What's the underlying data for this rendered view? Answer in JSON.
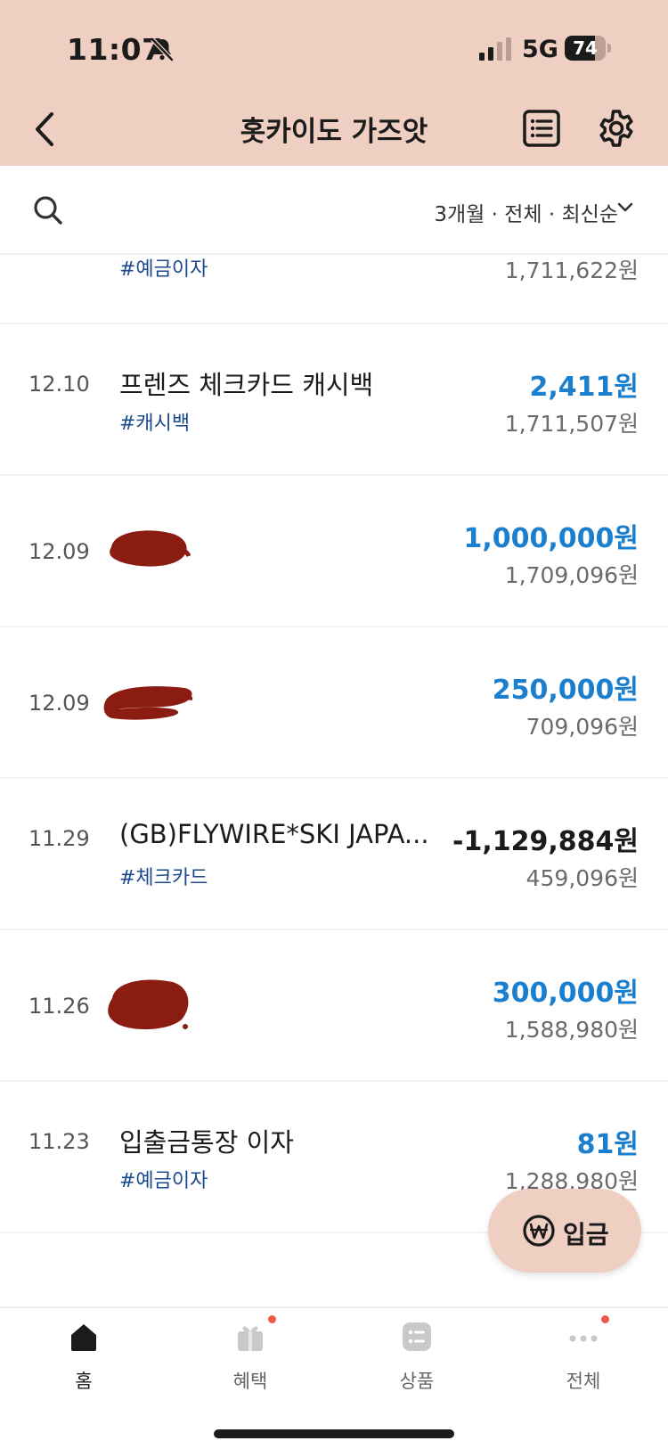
{
  "status_bar": {
    "time": "11:07",
    "network": "5G",
    "battery": 74,
    "battery_label": "74",
    "icons": [
      "bell-slash-icon",
      "signal-icon"
    ]
  },
  "nav": {
    "title": "홋카이도 가즈앗",
    "icons": [
      "back-icon",
      "list-icon",
      "gear-icon"
    ]
  },
  "filter": {
    "label": "3개월 · 전체 · 최신순",
    "icons": [
      "search-icon",
      "chevron-down-icon"
    ]
  },
  "transactions": [
    {
      "date": "",
      "name": "",
      "tag": "#예금이자",
      "amount": "",
      "balance": "1,711,622원"
    },
    {
      "date": "12.10",
      "name": "프렌즈 체크카드 캐시백",
      "tag": "#캐시백",
      "amount": "2,411원",
      "balance": "1,711,507원"
    },
    {
      "date": "12.09",
      "name": "",
      "tag": "",
      "amount": "1,000,000원",
      "balance": "1,709,096원"
    },
    {
      "date": "12.09",
      "name": "",
      "tag": "",
      "amount": "250,000원",
      "balance": "709,096원"
    },
    {
      "date": "11.29",
      "name": "(GB)FLYWIRE*SKI JAPA...",
      "tag": "#체크카드",
      "amount": "-1,129,884원",
      "balance": "459,096원"
    },
    {
      "date": "11.26",
      "name": "",
      "tag": "",
      "amount": "300,000원",
      "balance": "1,588,980원"
    },
    {
      "date": "11.23",
      "name": "입출금통장 이자",
      "tag": "#예금이자",
      "amount": "81원",
      "balance": "1,288,980원"
    }
  ],
  "deposit": {
    "label": "입금",
    "icon": "won-icon"
  },
  "tabs": [
    {
      "label": "홈",
      "icon": "home-icon",
      "active": true,
      "badge": false
    },
    {
      "label": "혜택",
      "icon": "gift-icon",
      "active": false,
      "badge": true
    },
    {
      "label": "상품",
      "icon": "products-icon",
      "active": false,
      "badge": false
    },
    {
      "label": "전체",
      "icon": "more-icon",
      "active": false,
      "badge": true
    }
  ],
  "colors": {
    "header_bg": "#eecfc2",
    "positive": "#1a7fce",
    "tag": "#1c4a8c",
    "badge": "#f0594a",
    "scribble": "#8b1c12"
  }
}
